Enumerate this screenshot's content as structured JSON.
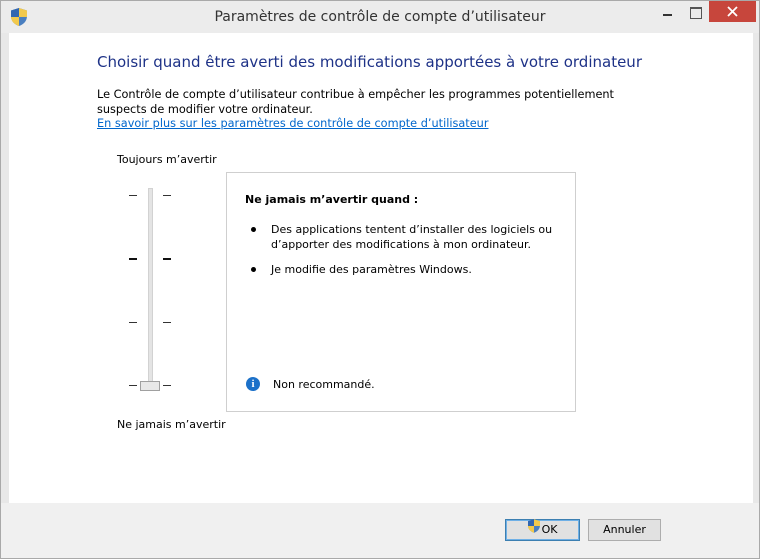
{
  "window": {
    "title": "Paramètres de contrôle de compte d’utilisateur"
  },
  "content": {
    "heading": "Choisir quand être averti des modifications apportées à votre ordinateur",
    "description": "Le Contrôle de compte d’utilisateur contribue à empêcher les programmes potentiellement suspects de modifier votre ordinateur.",
    "learn_more_link": "En savoir plus sur les paramètres de contrôle de compte d’utilisateur"
  },
  "slider": {
    "top_label": "Toujours m’avertir",
    "bottom_label": "Ne jamais m’avertir",
    "levels": 4,
    "selected_level": 1
  },
  "info": {
    "title": "Ne jamais m’avertir quand :",
    "bullets": [
      "Des applications tentent d’installer des logiciels ou d’apporter des modifications à mon ordinateur.",
      "Je modifie des paramètres Windows."
    ],
    "note": "Non recommandé."
  },
  "buttons": {
    "ok": "OK",
    "cancel": "Annuler"
  },
  "icons": {
    "title": "uac-shield-icon",
    "info": "info-icon",
    "ok": "uac-shield-icon"
  },
  "colors": {
    "heading": "#1e3287",
    "link": "#0066cc",
    "close_button": "#c7463c",
    "info_icon": "#1c71c9"
  }
}
